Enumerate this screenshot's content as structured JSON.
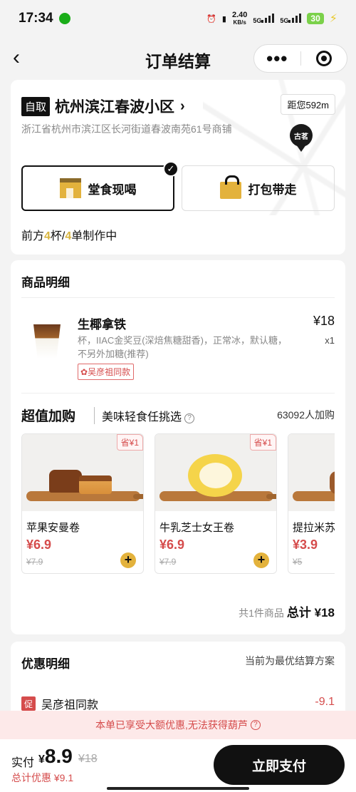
{
  "status_bar": {
    "time": "17:34",
    "net_speed": "2.40",
    "net_unit": "KB/s",
    "sig1": "5G",
    "sig2": "5G",
    "battery": "30"
  },
  "nav": {
    "title": "订单结算",
    "back_icon": "chevron-left",
    "more_icon": "•••"
  },
  "store": {
    "mode_tag": "自取",
    "name": "杭州滨江春波小区",
    "distance": "距您592m",
    "address": "浙江省杭州市滨江区长河街道春波南苑61号商铺",
    "pin_label": "古茗",
    "dine_in_label": "堂食现喝",
    "takeaway_label": "打包带走",
    "queue_prefix": "前方",
    "queue_cups": "4",
    "queue_mid": "杯/",
    "queue_orders": "4",
    "queue_suffix": "单制作中"
  },
  "goods": {
    "section_title": "商品明细",
    "item": {
      "name": "生椰拿铁",
      "desc": "杯，IIAC金奖豆(深焙焦糖甜香)，正常冰，默认糖，不另外加糖(推荐)",
      "tag": "吴彦祖同款",
      "price": "¥18",
      "qty": "x1"
    },
    "addon": {
      "title": "超值加购",
      "subtitle": "美味轻食任挑选",
      "count": "63092人加购",
      "tiles": [
        {
          "save": "省¥1",
          "name": "苹果安曼卷",
          "price": "¥6.9",
          "orig": "¥7.9"
        },
        {
          "save": "省¥1",
          "name": "牛乳芝士女王卷",
          "price": "¥6.9",
          "orig": "¥7.9"
        },
        {
          "save": "",
          "name": "提拉米苏",
          "price": "¥3.9",
          "orig": "¥5"
        }
      ]
    },
    "total_prefix": "共1件商品",
    "total_label": "总计 ¥18"
  },
  "discount": {
    "section_title": "优惠明细",
    "note": "当前为最优结算方案",
    "row_badge": "促",
    "row_label": "吴彦祖同款",
    "row_amount": "-9.1"
  },
  "notice": "本单已享受大额优惠,无法获得葫芦",
  "pay": {
    "label": "实付",
    "currency": "¥",
    "amount": "8.9",
    "original": "¥18",
    "total_discount": "总计优惠 ¥9.1",
    "button": "立即支付"
  },
  "colors": {
    "accent_gold": "#e3b23c",
    "price_red": "#d54c4c",
    "dark": "#111111"
  }
}
